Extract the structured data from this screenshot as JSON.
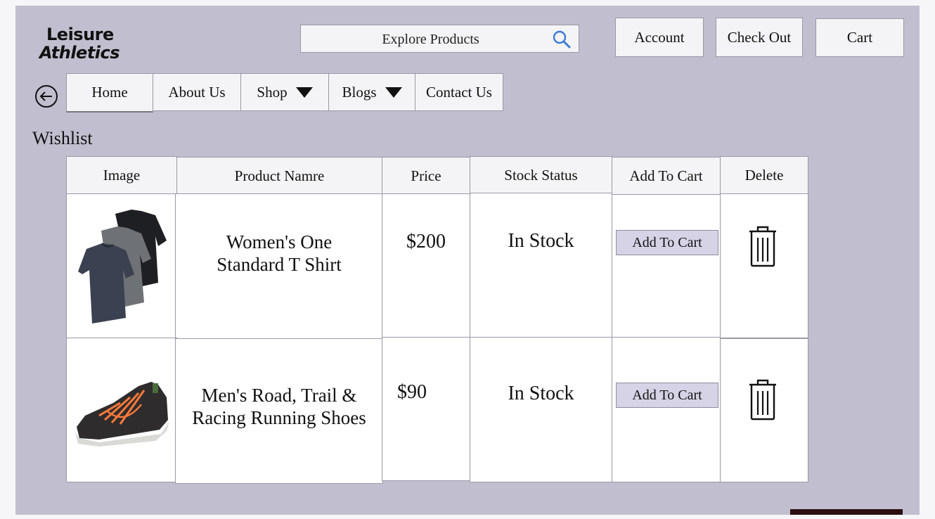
{
  "brand": {
    "line1": "Leisure",
    "line2": "Athletics"
  },
  "search": {
    "placeholder": "Explore Products",
    "icon": "search-icon"
  },
  "top_buttons": {
    "account": "Account",
    "checkout": "Check Out",
    "cart": "Cart"
  },
  "nav": {
    "back_icon": "back-arrow-icon",
    "items": [
      {
        "label": "Home"
      },
      {
        "label": "About Us"
      },
      {
        "label": "Shop",
        "dropdown": true
      },
      {
        "label": "Blogs",
        "dropdown": true
      },
      {
        "label": "Contact Us"
      }
    ]
  },
  "wishlist": {
    "title": "Wishlist",
    "columns": [
      "Image",
      "Product Namre",
      "Price",
      "Stock Status",
      "Add To Cart",
      "Delete"
    ],
    "rows": [
      {
        "image": "tshirt-image",
        "name_line1": "Women's One",
        "name_line2": "Standard T Shirt",
        "price": "$200",
        "stock": "In Stock",
        "add_label": "Add To Cart",
        "delete_icon": "trash-icon"
      },
      {
        "image": "shoe-image",
        "name_line1": "Men's Road, Trail &",
        "name_line2": "Racing Running Shoes",
        "price": "$90",
        "stock": "In Stock",
        "add_label": "Add To Cart",
        "delete_icon": "trash-icon"
      }
    ]
  },
  "colors": {
    "background": "#c1bfcf",
    "button_accent": "#d6d3e6"
  }
}
